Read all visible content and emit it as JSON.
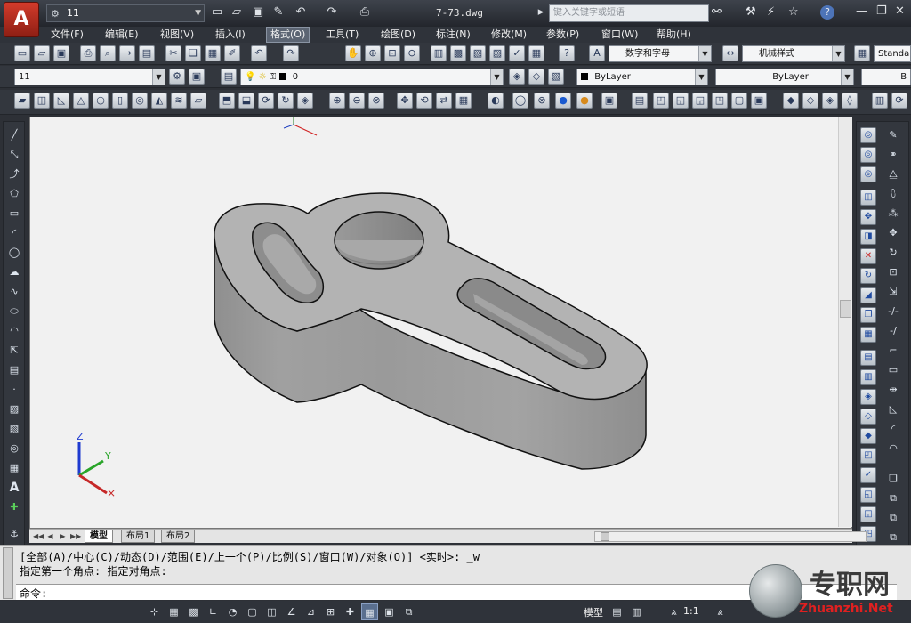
{
  "titlebar": {
    "app_button": "A",
    "workspace": "11",
    "document_title": "7-73.dwg",
    "search_placeholder": "键入关键字或短语",
    "help": "?"
  },
  "menu": [
    "文件(F)",
    "编辑(E)",
    "视图(V)",
    "插入(I)",
    "格式(O)",
    "工具(T)",
    "绘图(D)",
    "标注(N)",
    "修改(M)",
    "参数(P)",
    "窗口(W)",
    "帮助(H)"
  ],
  "styles_toolbar": {
    "text_style": "数字和字母",
    "dim_style": "机械样式",
    "table_style": "Standa"
  },
  "layers_toolbar": {
    "workspace_combo": "11",
    "layer": "0",
    "color": "ByLayer",
    "linetype": "ByLayer",
    "lineweight": "B"
  },
  "ucs": {
    "z": "Z",
    "y": "Y"
  },
  "layout_tabs": [
    "模型",
    "布局1",
    "布局2"
  ],
  "command": {
    "line1": "[全部(A)/中心(C)/动态(D)/范围(E)/上一个(P)/比例(S)/窗口(W)/对象(O)] <实时>: _w",
    "line2": "指定第一个角点: 指定对角点:",
    "prompt": "命令:"
  },
  "statusbar": {
    "model_label": "模型",
    "scale_label": "1:1"
  },
  "watermark": {
    "text": "专职网",
    "url": "Zhuanzhi.Net"
  },
  "colors": {
    "accent_red": "#c8281b",
    "canvas_bg": "#f1f1f1",
    "model_fill": "#a6a6a6"
  }
}
